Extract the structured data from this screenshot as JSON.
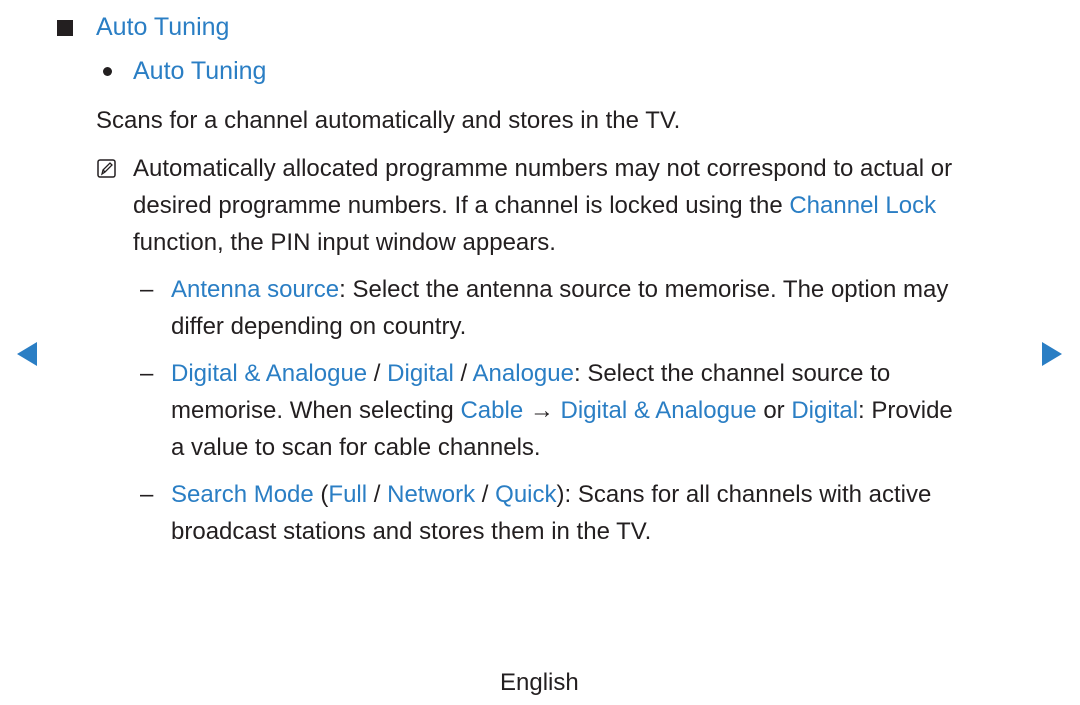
{
  "heading": {
    "title": "Auto Tuning"
  },
  "subheading": {
    "title": "Auto Tuning"
  },
  "description": "Scans for a channel automatically and stores in the TV.",
  "note": {
    "icon": "note-pencil-icon",
    "line1": "Automatically allocated programme numbers may not correspond to actual or",
    "line2_pre": "desired programme numbers. If a channel is locked using the ",
    "line2_link": "Channel Lock",
    "line3": "function, the PIN input window appears."
  },
  "items": {
    "antenna": {
      "link": "Antenna source",
      "text1": ": Select the antenna source to memorise. The option may",
      "text2": "differ depending on country."
    },
    "source": {
      "link1": "Digital & Analogue",
      "sep1": " / ",
      "link2": "Digital",
      "sep2": " / ",
      "link3": "Analogue",
      "text1": ": Select the channel source to",
      "l2_pre": "memorise. When selecting ",
      "l2_link1": "Cable",
      "l2_arrow": " → ",
      "l2_link2": "Digital & Analogue",
      "l2_or": " or ",
      "l2_link3": "Digital",
      "l2_post": ": Provide",
      "text3": "a value to scan for cable channels."
    },
    "search": {
      "link1": "Search Mode",
      "p1": " (",
      "link2": "Full",
      "sep1": " / ",
      "link3": "Network",
      "sep2": " / ",
      "link4": "Quick",
      "text1": "): Scans for all channels with active",
      "text2": "broadcast stations and stores them in the TV."
    },
    "dash": "–"
  },
  "navigation": {
    "prev": "previous-page-arrow",
    "next": "next-page-arrow"
  },
  "footer": {
    "language": "English"
  },
  "colors": {
    "accent": "#2a7ec4",
    "text": "#231f20"
  }
}
